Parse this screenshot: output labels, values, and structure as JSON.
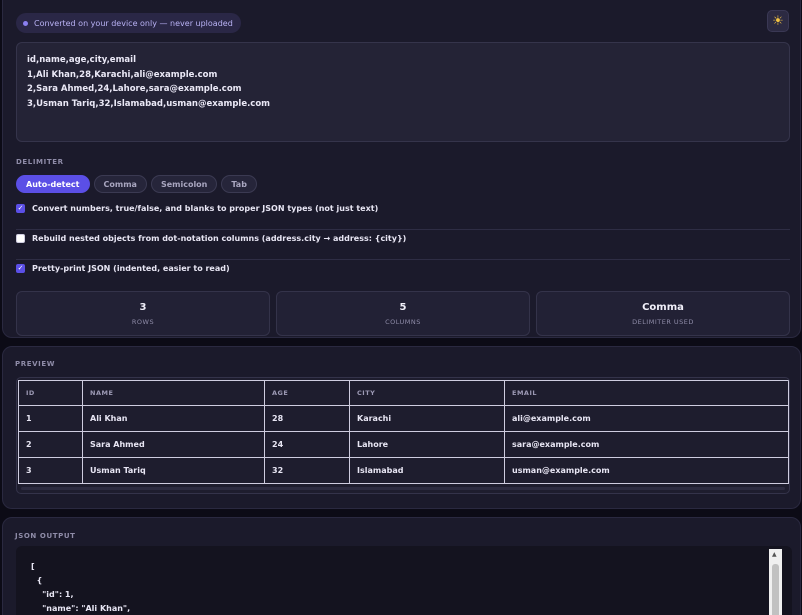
{
  "privacy_note": "Converted on your device only — never uploaded",
  "theme_toggle_icon": "☀",
  "csv_input": "id,name,age,city,email\n1,Ali Khan,28,Karachi,ali@example.com\n2,Sara Ahmed,24,Lahore,sara@example.com\n3,Usman Tariq,32,Islamabad,usman@example.com",
  "delimiter": {
    "label": "DELIMITER",
    "options": [
      "Auto-detect",
      "Comma",
      "Semicolon",
      "Tab"
    ],
    "selected": "Auto-detect"
  },
  "options": [
    {
      "label": "Convert numbers, true/false, and blanks to proper JSON types (not just text)",
      "checked": true
    },
    {
      "label": "Rebuild nested objects from dot-notation columns (address.city → address: {city})",
      "checked": false
    },
    {
      "label": "Pretty-print JSON (indented, easier to read)",
      "checked": true
    }
  ],
  "stats": [
    {
      "value": "3",
      "label": "ROWS"
    },
    {
      "value": "5",
      "label": "COLUMNS"
    },
    {
      "value": "Comma",
      "label": "DELIMITER USED"
    }
  ],
  "preview": {
    "label": "PREVIEW",
    "columns": [
      "ID",
      "NAME",
      "AGE",
      "CITY",
      "EMAIL"
    ],
    "rows": [
      [
        "1",
        "Ali Khan",
        "28",
        "Karachi",
        "ali@example.com"
      ],
      [
        "2",
        "Sara Ahmed",
        "24",
        "Lahore",
        "sara@example.com"
      ],
      [
        "3",
        "Usman Tariq",
        "32",
        "Islamabad",
        "usman@example.com"
      ]
    ]
  },
  "output": {
    "label": "JSON OUTPUT",
    "code": "[\n  {\n    \"id\": 1,\n    \"name\": \"Ali Khan\","
  },
  "colors": {
    "accent": "#5b4fe6",
    "panel": "#1b1a2b",
    "background": "#0c0b16"
  }
}
